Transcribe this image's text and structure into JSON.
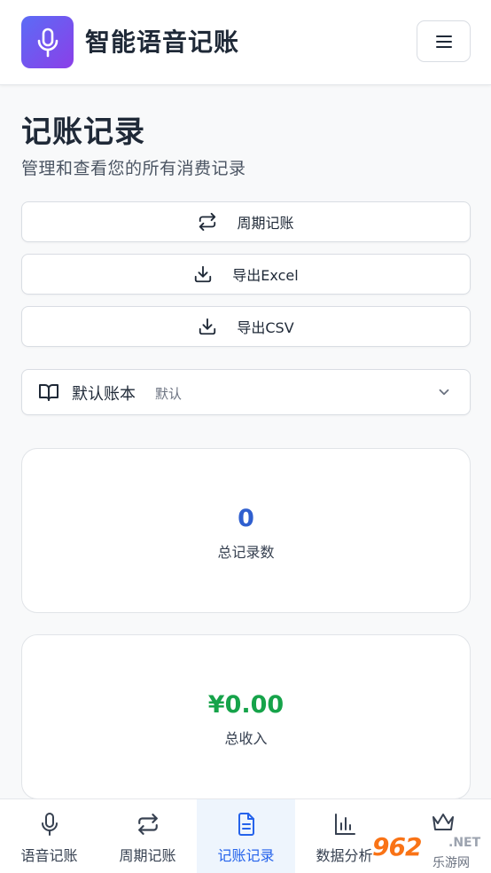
{
  "header": {
    "app_title": "智能语音记账",
    "logo_icon": "microphone-icon",
    "menu_icon": "hamburger-menu-icon",
    "logo_gradient": [
      "#5b6cf6",
      "#8b3fe8"
    ]
  },
  "page": {
    "title": "记账记录",
    "subtitle": "管理和查看您的所有消费记录"
  },
  "actions": [
    {
      "label": "周期记账",
      "icon": "repeat-icon"
    },
    {
      "label": "导出Excel",
      "icon": "download-icon"
    },
    {
      "label": "导出CSV",
      "icon": "download-icon"
    }
  ],
  "account_book": {
    "name": "默认账本",
    "tag": "默认",
    "icon": "book-icon"
  },
  "stats": [
    {
      "value": "0",
      "label": "总记录数",
      "color": "#2f5fcf"
    },
    {
      "value": "¥0.00",
      "label": "总收入",
      "color": "#16a34a"
    }
  ],
  "bottom_nav": [
    {
      "label": "语音记账",
      "icon": "microphone-icon",
      "active": false
    },
    {
      "label": "周期记账",
      "icon": "repeat-icon",
      "active": false
    },
    {
      "label": "记账记录",
      "icon": "document-icon",
      "active": true
    },
    {
      "label": "数据分析",
      "icon": "bar-chart-icon",
      "active": false
    },
    {
      "label": "",
      "icon": "crown-icon",
      "active": false
    }
  ],
  "watermark": {
    "number": "962",
    "suffix": ".NET",
    "text": "乐游网"
  },
  "colors": {
    "accent": "#2563eb",
    "income": "#16a34a",
    "count": "#2f5fcf"
  }
}
